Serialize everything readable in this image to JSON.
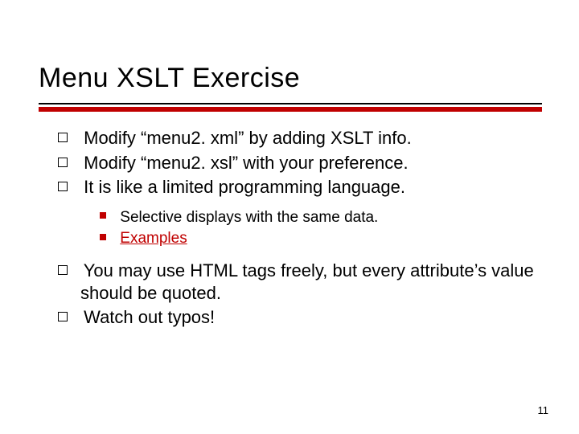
{
  "title": "Menu XSLT Exercise",
  "bullets_top": [
    "Modify “menu2. xml” by adding XSLT info.",
    "Modify “menu2. xsl” with your preference.",
    "It is like a limited programming language."
  ],
  "nested": {
    "line1": "Selective displays with the same data.",
    "line2_link": "Examples"
  },
  "bullets_bottom": [
    "You may use HTML tags freely, but every attribute’s value should be quoted.",
    "Watch out typos!"
  ],
  "page_number": "11"
}
